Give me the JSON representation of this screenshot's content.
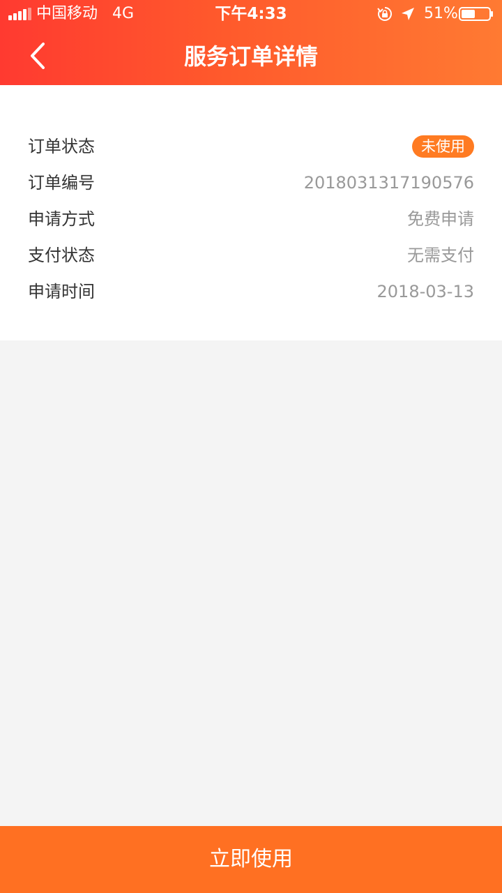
{
  "status_bar": {
    "carrier": "中国移动",
    "network": "4G",
    "time": "下午4:33",
    "battery_percent": "51%",
    "battery_level": 0.51,
    "icons": [
      "signal-icon",
      "rotation-lock-icon",
      "location-arrow-icon",
      "battery-icon"
    ]
  },
  "header": {
    "title": "服务订单详情",
    "back_icon": "chevron-left-icon"
  },
  "order_details": {
    "rows": [
      {
        "label": "订单状态",
        "value": "未使用"
      },
      {
        "label": "订单编号",
        "value": "2018031317190576"
      },
      {
        "label": "申请方式",
        "value": "免费申请"
      },
      {
        "label": "支付状态",
        "value": "无需支付"
      },
      {
        "label": "申请时间",
        "value": "2018-03-13"
      }
    ]
  },
  "footer": {
    "button_label": "立即使用"
  },
  "colors": {
    "header_gradient_start": "#ff3a30",
    "header_gradient_end": "#ff7a32",
    "badge": "#ff7b22",
    "primary_button": "#ff7022",
    "page_background": "#f4f4f4",
    "label_text": "#333333",
    "value_text": "#999999"
  }
}
